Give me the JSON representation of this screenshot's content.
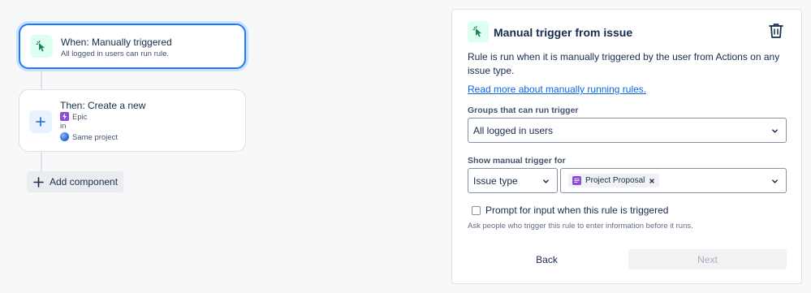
{
  "canvas": {
    "trigger_card": {
      "title": "When: Manually triggered",
      "subtitle": "All logged in users can run rule.",
      "icon": "cursor-click-icon"
    },
    "action_card": {
      "title": "Then: Create a new",
      "issue_type": "Epic",
      "in_label": "in",
      "project": "Same project",
      "icon": "plus-icon"
    },
    "add_component_label": "Add component"
  },
  "panel": {
    "title": "Manual trigger from issue",
    "description": "Rule is run when it is manually triggered by the user from Actions on any issue type.",
    "link_text": "Read more about manually running rules.",
    "groups_label": "Groups that can run trigger",
    "groups_value": "All logged in users",
    "show_label": "Show manual trigger for",
    "show_type_value": "Issue type",
    "selected_issue_type": "Project Proposal",
    "checkbox_label": "Prompt for input when this rule is triggered",
    "checkbox_checked": false,
    "help_text": "Ask people who trigger this rule to enter information before it runs.",
    "back_label": "Back",
    "next_label": "Next"
  },
  "colors": {
    "accent": "#1d7afc",
    "trigger_icon_bg": "#dcfff1",
    "trigger_icon_fg": "#1f845a",
    "action_icon_bg": "#e9f2ff",
    "action_icon_fg": "#0c66e4",
    "epic": "#8f4bde",
    "proposal": "#8f4bde"
  }
}
